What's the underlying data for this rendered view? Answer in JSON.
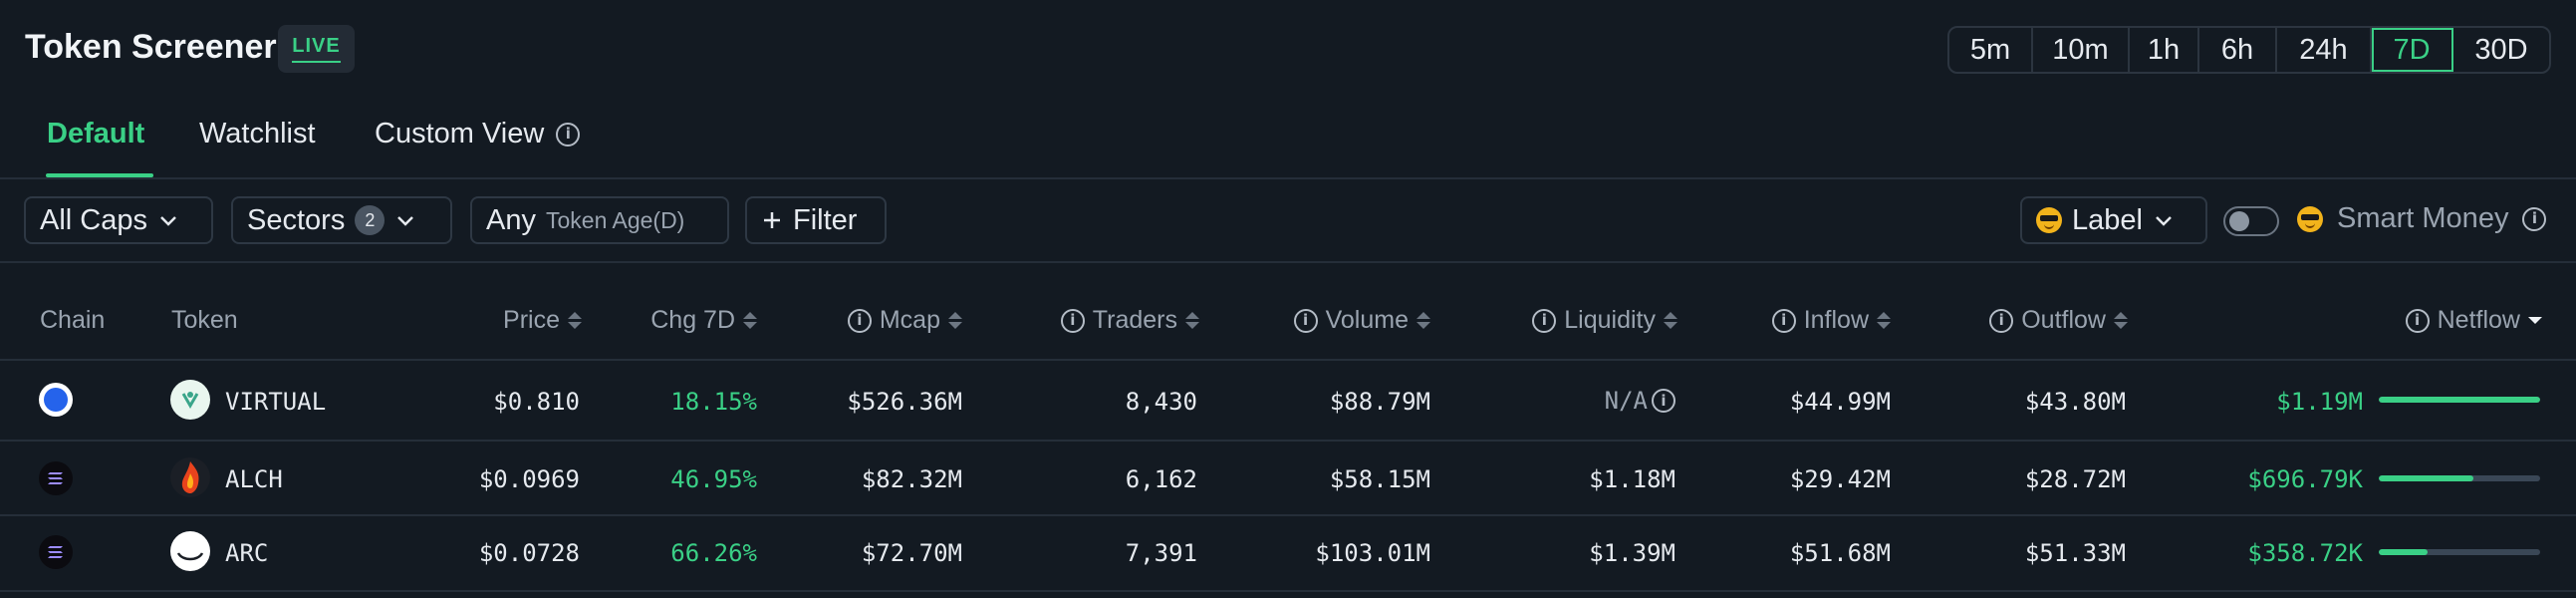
{
  "header": {
    "title": "Token Screener",
    "live_badge": "LIVE",
    "timeframes": [
      "5m",
      "10m",
      "1h",
      "6h",
      "24h",
      "7D",
      "30D"
    ],
    "active_timeframe": "7D"
  },
  "tabs": {
    "default": "Default",
    "watchlist": "Watchlist",
    "custom_view": "Custom View",
    "active": "Default"
  },
  "filters": {
    "caps": "All Caps",
    "sectors": "Sectors",
    "sectors_count": "2",
    "age_value": "Any",
    "age_label": "Token Age(D)",
    "filter": "Filter",
    "label": "Label",
    "smart_money": "Smart Money",
    "smart_money_enabled": false
  },
  "table": {
    "columns": {
      "chain": "Chain",
      "token": "Token",
      "price": "Price",
      "chg": "Chg 7D",
      "mcap": "Mcap",
      "traders": "Traders",
      "volume": "Volume",
      "liquidity": "Liquidity",
      "inflow": "Inflow",
      "outflow": "Outflow",
      "netflow": "Netflow"
    },
    "rows": [
      {
        "chain_icon": "base-chain-icon",
        "token_icon": "virtual-token-icon",
        "token": "VIRTUAL",
        "price": "$0.810",
        "chg": "18.15%",
        "mcap": "$526.36M",
        "traders": "8,430",
        "volume": "$88.79M",
        "liquidity": "N/A",
        "inflow": "$44.99M",
        "outflow": "$43.80M",
        "netflow": "$1.19M",
        "netflow_bar": 1.0
      },
      {
        "chain_icon": "solana-chain-icon",
        "token_icon": "alch-token-icon",
        "token": "ALCH",
        "price": "$0.0969",
        "chg": "46.95%",
        "mcap": "$82.32M",
        "traders": "6,162",
        "volume": "$58.15M",
        "liquidity": "$1.18M",
        "inflow": "$29.42M",
        "outflow": "$28.72M",
        "netflow": "$696.79K",
        "netflow_bar": 0.585
      },
      {
        "chain_icon": "solana-chain-icon",
        "token_icon": "arc-token-icon",
        "token": "ARC",
        "price": "$0.0728",
        "chg": "66.26%",
        "mcap": "$72.70M",
        "traders": "7,391",
        "volume": "$103.01M",
        "liquidity": "$1.39M",
        "inflow": "$51.68M",
        "outflow": "$51.33M",
        "netflow": "$358.72K",
        "netflow_bar": 0.3
      }
    ]
  },
  "colors": {
    "background": "#131a22",
    "accent_green": "#3ad086",
    "muted_text": "#9aa4b0"
  }
}
